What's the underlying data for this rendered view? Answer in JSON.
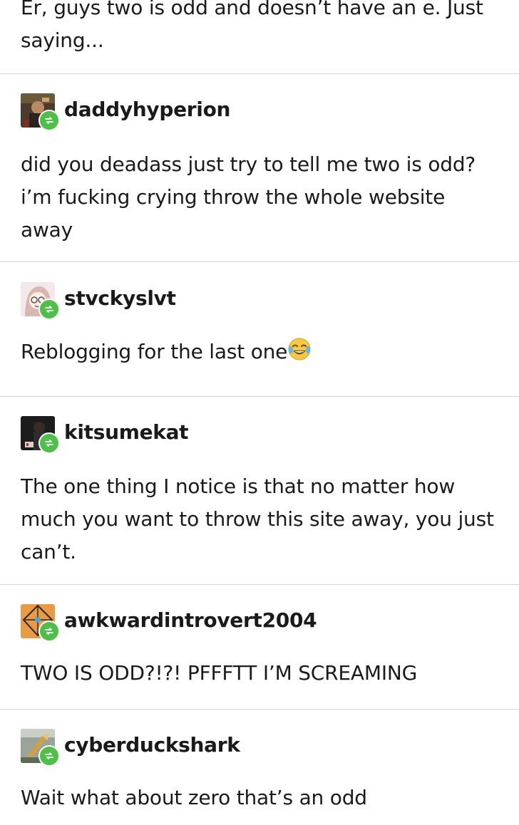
{
  "intro_text": "Er, guys two is odd and doesn’t have an e. Just\nsaying...",
  "posts": [
    {
      "username": "daddyhyperion",
      "avatar_icon": "avatar-daddyhyperion",
      "text": "did you deadass just try to tell me two is odd?\ni’m fucking crying throw the whole website\naway"
    },
    {
      "username": "stvckyslvt",
      "avatar_icon": "avatar-stvckyslvt",
      "text": "Reblogging for the last one",
      "emoji": "face-with-tears-of-joy-emoji"
    },
    {
      "username": "kitsumekat",
      "avatar_icon": "avatar-kitsumekat",
      "text": "The one thing I notice is that no matter how\nmuch you want to throw this site away, you just\ncan’t."
    },
    {
      "username": "awkwardintrovert2004",
      "avatar_icon": "avatar-awkwardintrovert2004",
      "text": "TWO IS ODD?!?! PFFFTT I’M SCREAMING"
    },
    {
      "username": "cyberduckshark",
      "avatar_icon": "avatar-cyberduckshark",
      "text": "Wait what about zero that’s an odd"
    }
  ],
  "colors": {
    "reblog_badge": "#4fbf4a",
    "divider": "#d6d6d6",
    "text": "#1a1a1a"
  }
}
